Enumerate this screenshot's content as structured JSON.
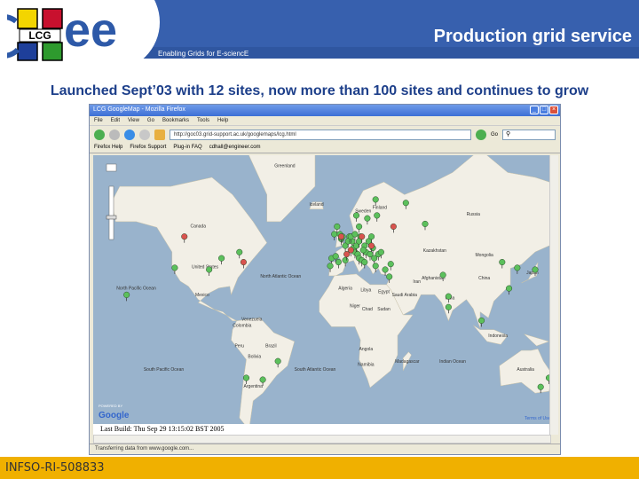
{
  "header": {
    "title": "Production grid service",
    "tagline": "Enabling Grids for E-sciencE",
    "logo_text": "LCG egee"
  },
  "subtitle": "Launched Sept’03 with 12 sites, now more than 100 sites and continues to grow",
  "browser": {
    "window_title": "LCG GoogleMap - Mozilla Firefox",
    "menu": [
      "File",
      "Edit",
      "View",
      "Go",
      "Bookmarks",
      "Tools",
      "Help"
    ],
    "url": "http://goc03.grid-support.ac.uk/googlemaps/lcg.html",
    "go_label": "Go",
    "bookmarks": [
      "Firefox Help",
      "Firefox Support",
      "Plug-in FAQ",
      "cdhall@engineer.com"
    ],
    "last_build": "Last Build: Thu Sep 29 13:15:02 BST 2005",
    "status": "Transferring data from www.google.com...",
    "map_logo": "Google",
    "map_powered": "POWERED BY",
    "terms": "Terms of Use"
  },
  "map": {
    "land_color": "#f2efe6",
    "ocean_color": "#99b3cc",
    "green": "#5cc05c",
    "red": "#d9534f",
    "labels": [
      "Greenland",
      "Canada",
      "United States",
      "North Pacific Ocean",
      "North Atlantic Ocean",
      "Russia",
      "Kazakhstan",
      "Mongolia",
      "China",
      "India",
      "Brazil",
      "Peru",
      "Argentina",
      "Algeria",
      "Libya",
      "Egypt",
      "Sudan",
      "South Pacific Ocean",
      "South Atlantic Ocean",
      "Indian Ocean",
      "Australia",
      "Madagascar",
      "Iceland",
      "Sweden",
      "Finland",
      "Afghanistan",
      "Iran",
      "Saudi Arabia",
      "Niger",
      "Chad",
      "Angola",
      "Namibia",
      "Bolivia",
      "Colombia",
      "Venezuela",
      "Mexico",
      "Japan",
      "Indonesia"
    ],
    "sites": [
      [
        -3,
        40,
        "g"
      ],
      [
        -8,
        42,
        "g"
      ],
      [
        2,
        41,
        "g"
      ],
      [
        -1,
        51,
        "g"
      ],
      [
        -2,
        53,
        "g"
      ],
      [
        -4,
        56,
        "g"
      ],
      [
        -6,
        53,
        "g"
      ],
      [
        0,
        52,
        "g"
      ],
      [
        2,
        48,
        "g"
      ],
      [
        5,
        52,
        "g"
      ],
      [
        4,
        50,
        "g"
      ],
      [
        7,
        50,
        "g"
      ],
      [
        8,
        47,
        "g"
      ],
      [
        9,
        45,
        "g"
      ],
      [
        11,
        44,
        "g"
      ],
      [
        12,
        42,
        "g"
      ],
      [
        14,
        41,
        "g"
      ],
      [
        16,
        40,
        "g"
      ],
      [
        10,
        48,
        "g"
      ],
      [
        13,
        52,
        "g"
      ],
      [
        12,
        50,
        "g"
      ],
      [
        16,
        48,
        "g"
      ],
      [
        19,
        50,
        "g"
      ],
      [
        21,
        52,
        "g"
      ],
      [
        17,
        45,
        "g"
      ],
      [
        20,
        44,
        "g"
      ],
      [
        23,
        42,
        "g"
      ],
      [
        24,
        38,
        "g"
      ],
      [
        26,
        44,
        "g"
      ],
      [
        28,
        45,
        "g"
      ],
      [
        22,
        47,
        "g"
      ],
      [
        25,
        60,
        "g"
      ],
      [
        18,
        59,
        "g"
      ],
      [
        10,
        60,
        "g"
      ],
      [
        24,
        65,
        "g"
      ],
      [
        35,
        39,
        "g"
      ],
      [
        31,
        36,
        "g"
      ],
      [
        34,
        32,
        "g"
      ],
      [
        12,
        56,
        "g"
      ],
      [
        6,
        52,
        "g"
      ],
      [
        9,
        53,
        "g"
      ],
      [
        15,
        46,
        "g"
      ],
      [
        -9,
        38,
        "g"
      ],
      [
        -5,
        43,
        "g"
      ],
      [
        37,
        56,
        "r"
      ],
      [
        6,
        46,
        "r"
      ],
      [
        14,
        52,
        "r"
      ],
      [
        3,
        44,
        "r"
      ],
      [
        -1,
        52,
        "r"
      ],
      [
        21,
        48,
        "r"
      ],
      [
        -115,
        52,
        "r"
      ],
      [
        -75,
        45,
        "g"
      ],
      [
        -88,
        42,
        "g"
      ],
      [
        -122,
        37,
        "g"
      ],
      [
        -72,
        40,
        "r"
      ],
      [
        -97,
        36,
        "g"
      ],
      [
        -157,
        21,
        "g"
      ],
      [
        77,
        20,
        "g"
      ],
      [
        121,
        25,
        "g"
      ],
      [
        127,
        37,
        "g"
      ],
      [
        140,
        36,
        "g"
      ],
      [
        150,
        -33,
        "g"
      ],
      [
        101,
        4,
        "g"
      ],
      [
        77,
        13,
        "g"
      ],
      [
        73,
        33,
        "g"
      ],
      [
        60,
        57,
        "g"
      ],
      [
        116,
        40,
        "g"
      ],
      [
        -47,
        -23,
        "g"
      ],
      [
        -70,
        -33,
        "g"
      ],
      [
        -58,
        -34,
        "g"
      ],
      [
        144,
        -38,
        "g"
      ],
      [
        46,
        64,
        "g"
      ]
    ]
  },
  "footer": {
    "text": "INFSO-RI-508833"
  }
}
